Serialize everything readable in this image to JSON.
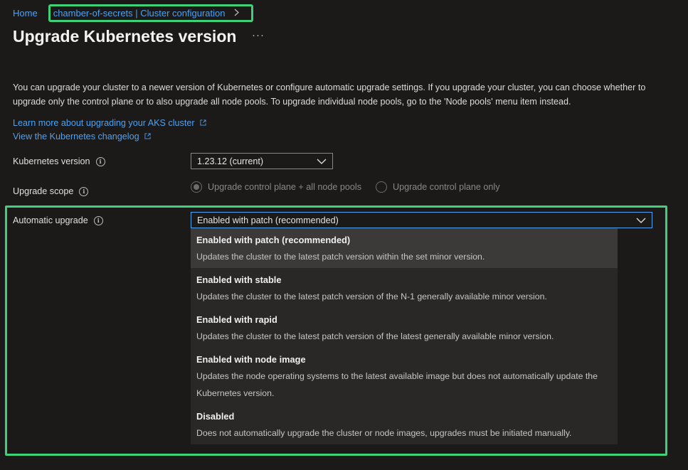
{
  "breadcrumb": {
    "home": "Home",
    "current": "chamber-of-secrets | Cluster configuration"
  },
  "page": {
    "title": "Upgrade Kubernetes version",
    "more": "···",
    "description": "You can upgrade your cluster to a newer version of Kubernetes or configure automatic upgrade settings. If you upgrade your cluster, you can choose whether to upgrade only the control plane or to also upgrade all node pools. To upgrade individual node pools, go to the 'Node pools' menu item instead.",
    "link_learn": "Learn more about upgrading your AKS cluster",
    "link_changelog": "View the Kubernetes changelog"
  },
  "form": {
    "k8s_label": "Kubernetes version",
    "k8s_value": "1.23.12 (current)",
    "scope_label": "Upgrade scope",
    "scope_opt1": "Upgrade control plane + all node pools",
    "scope_opt2": "Upgrade control plane only",
    "auto_label": "Automatic upgrade",
    "auto_value": "Enabled with patch (recommended)"
  },
  "dropdown": {
    "options": [
      {
        "title": "Enabled with patch (recommended)",
        "desc": "Updates the cluster to the latest patch version within the set minor version."
      },
      {
        "title": "Enabled with stable",
        "desc": "Updates the cluster to the latest patch version of the N-1 generally available minor version."
      },
      {
        "title": "Enabled with rapid",
        "desc": "Updates the cluster to the latest patch version of the latest generally available minor version."
      },
      {
        "title": "Enabled with node image",
        "desc": "Updates the node operating systems to the latest available image but does not automatically update the Kubernetes version."
      },
      {
        "title": "Disabled",
        "desc": "Does not automatically upgrade the cluster or node images, upgrades must be initiated manually."
      }
    ],
    "selected_index": 0
  },
  "colors": {
    "accent": "#4ea1f0",
    "highlight": "#3fd07a",
    "background": "#1b1a19"
  }
}
